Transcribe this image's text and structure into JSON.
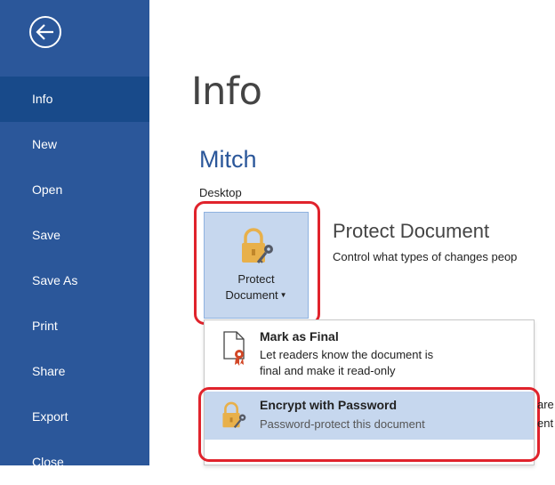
{
  "sidebar": {
    "back_label": "Back",
    "items": [
      {
        "label": "Info",
        "active": true
      },
      {
        "label": "New"
      },
      {
        "label": "Open"
      },
      {
        "label": "Save"
      },
      {
        "label": "Save As"
      },
      {
        "label": "Print"
      },
      {
        "label": "Share"
      },
      {
        "label": "Export"
      },
      {
        "label": "Close"
      }
    ]
  },
  "main": {
    "title": "Info",
    "document_name": "Mitch",
    "document_location": "Desktop",
    "protect": {
      "button_line1": "Protect",
      "button_line2": "Document",
      "heading": "Protect Document",
      "description": "Control what types of changes peop"
    },
    "menu": {
      "items": [
        {
          "title": "Mark as Final",
          "title_access_key": "F",
          "description_line1": "Let readers know the document is",
          "description_line2": "final and make it read-only"
        },
        {
          "title": "Encrypt with Password",
          "title_access_key": "E",
          "description": "Password-protect this document"
        }
      ]
    },
    "clipped_text": {
      "line1": "are",
      "line2": "ent"
    }
  },
  "colors": {
    "sidebar_bg": "#2b579a",
    "sidebar_active": "#184a8a",
    "accent_blue": "#2b579a",
    "highlight": "#c6d7ee",
    "annotation_red": "#e0232c",
    "lock_gold": "#e8b04a"
  },
  "icons": {
    "back": "back-arrow-circle-icon",
    "protect": "lock-with-key-icon",
    "mark_final": "document-with-ribbon-icon",
    "encrypt": "lock-with-key-icon"
  }
}
